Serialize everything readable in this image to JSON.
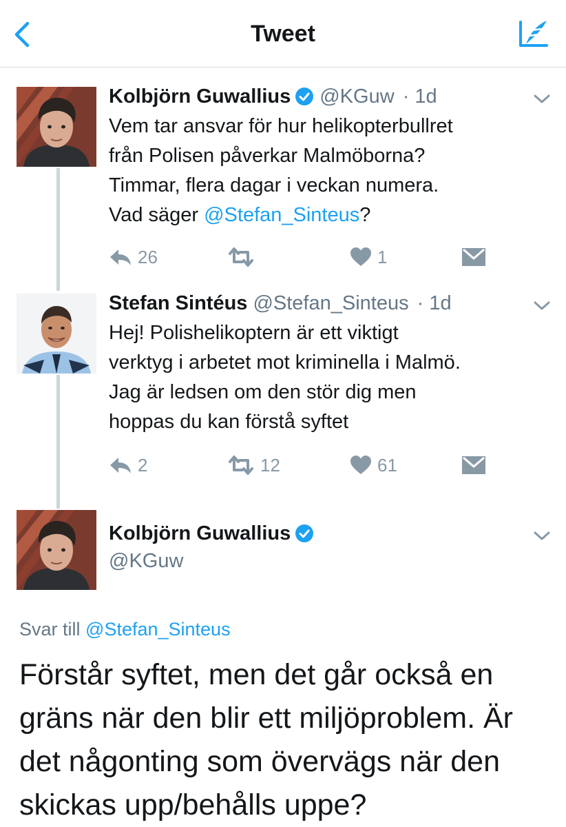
{
  "header": {
    "title": "Tweet",
    "back_icon": "chevron-left-icon",
    "compose_icon": "compose-tweet-icon",
    "accent": "#1da1f2"
  },
  "tweets": [
    {
      "name": "Kolbjörn Guwallius",
      "verified": true,
      "handle": "@KGuw",
      "time": "· 1d",
      "text_lines": [
        "Vem tar ansvar för hur helikopterbullret",
        "från Polisen påverkar Malmöborna?",
        "Timmar, flera dagar i veckan numera."
      ],
      "text_last_prefix": "Vad säger ",
      "text_last_mention": "@Stefan_Sinteus",
      "text_last_suffix": "?",
      "replies": "26",
      "retweets": "",
      "likes": "1"
    },
    {
      "name": "Stefan Sintéus",
      "verified": false,
      "handle": "@Stefan_Sinteus",
      "time": "· 1d",
      "text_lines": [
        "Hej! Polishelikoptern är ett viktigt",
        "verktyg i arbetet mot kriminella i Malmö.",
        "Jag är ledsen om den stör dig men",
        "hoppas du kan förstå syftet"
      ],
      "replies": "2",
      "retweets": "12",
      "likes": "61"
    }
  ],
  "main_tweet": {
    "name": "Kolbjörn Guwallius",
    "verified": true,
    "handle": "@KGuw",
    "reply_prefix": "Svar till ",
    "reply_mention": "@Stefan_Sinteus",
    "text_lines": [
      "Förstår syftet, men det går också en",
      "gräns när den blir ett miljöproblem. Är",
      "det någonting som övervägs när den",
      "skickas upp/behålls uppe?"
    ]
  },
  "colors": {
    "mention": "#1da1f2",
    "secondary_text": "#657786",
    "action_icon": "#8899a6",
    "verified_badge": "#1da1f2",
    "thread_line": "#ccd6dd"
  }
}
